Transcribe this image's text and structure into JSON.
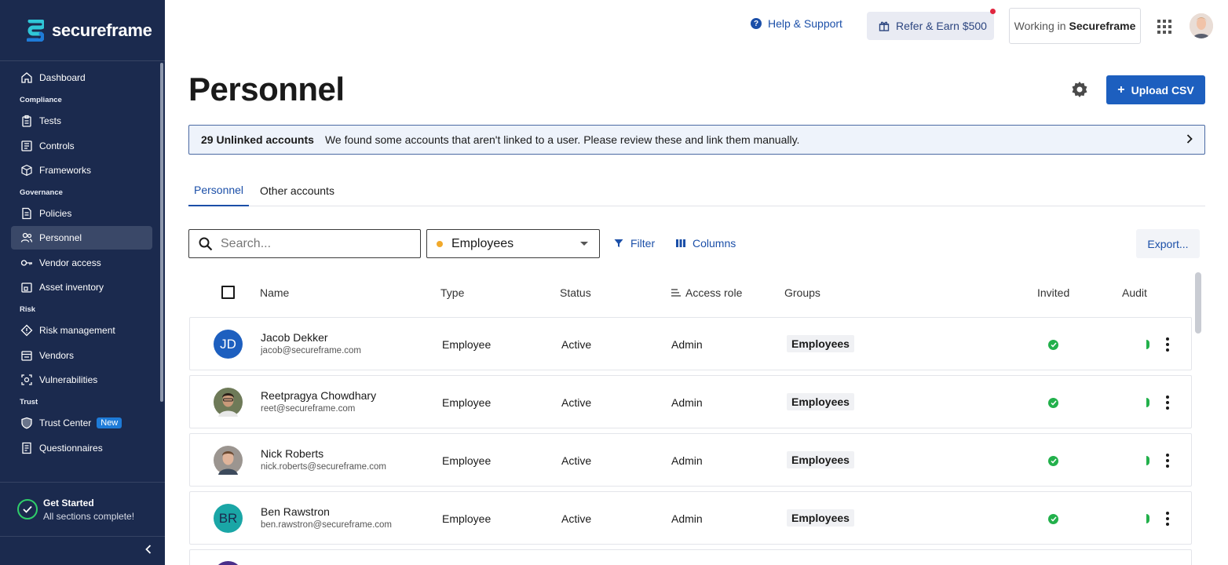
{
  "brand": {
    "name": "secureframe",
    "color": "#1b2a4e",
    "accent": "#1d5fbf"
  },
  "sidebar": {
    "items": [
      {
        "kind": "item",
        "label": "Dashboard",
        "icon": "home-icon"
      },
      {
        "kind": "section",
        "label": "Compliance"
      },
      {
        "kind": "item",
        "label": "Tests",
        "icon": "clipboard-icon"
      },
      {
        "kind": "item",
        "label": "Controls",
        "icon": "sliders-icon"
      },
      {
        "kind": "item",
        "label": "Frameworks",
        "icon": "cube-icon"
      },
      {
        "kind": "section",
        "label": "Governance"
      },
      {
        "kind": "item",
        "label": "Policies",
        "icon": "document-icon"
      },
      {
        "kind": "item",
        "label": "Personnel",
        "icon": "users-icon",
        "active": true
      },
      {
        "kind": "item",
        "label": "Vendor access",
        "icon": "key-icon"
      },
      {
        "kind": "item",
        "label": "Asset inventory",
        "icon": "device-icon"
      },
      {
        "kind": "section",
        "label": "Risk"
      },
      {
        "kind": "item",
        "label": "Risk management",
        "icon": "diamond-icon"
      },
      {
        "kind": "item",
        "label": "Vendors",
        "icon": "store-icon"
      },
      {
        "kind": "item",
        "label": "Vulnerabilities",
        "icon": "bug-icon"
      },
      {
        "kind": "section",
        "label": "Trust"
      },
      {
        "kind": "item",
        "label": "Trust Center",
        "icon": "shield-icon",
        "badge": "New"
      },
      {
        "kind": "item",
        "label": "Questionnaires",
        "icon": "list-icon"
      }
    ],
    "get_started": {
      "title": "Get Started",
      "subtitle": "All sections complete!"
    }
  },
  "topbar": {
    "help": "Help & Support",
    "refer": "Refer & Earn $500",
    "working_prefix": "Working in",
    "working_org": "Secureframe"
  },
  "page": {
    "title": "Personnel",
    "upload_label": "Upload CSV",
    "banner": {
      "count": "29 Unlinked accounts",
      "message": "We found some accounts that aren't linked to a user. Please review these and link them manually."
    },
    "tabs": [
      "Personnel",
      "Other accounts"
    ],
    "search_placeholder": "Search...",
    "select_value": "Employees",
    "filter_label": "Filter",
    "columns_label": "Columns",
    "export_label": "Export..."
  },
  "table": {
    "headers": {
      "name": "Name",
      "type": "Type",
      "status": "Status",
      "access_role": "Access role",
      "groups": "Groups",
      "invited": "Invited",
      "audit": "Audit"
    },
    "rows": [
      {
        "initials": "JD",
        "avatar_color": "#1d5fbf",
        "name": "Jacob Dekker",
        "email": "jacob@secureframe.com",
        "type": "Employee",
        "status": "Active",
        "role": "Admin",
        "group": "Employees"
      },
      {
        "initials": "",
        "avatar_color": "#5b4a3a",
        "name": "Reetpragya Chowdhary",
        "email": "reet@secureframe.com",
        "type": "Employee",
        "status": "Active",
        "role": "Admin",
        "group": "Employees"
      },
      {
        "initials": "",
        "avatar_color": "#7a6a5a",
        "name": "Nick Roberts",
        "email": "nick.roberts@secureframe.com",
        "type": "Employee",
        "status": "Active",
        "role": "Admin",
        "group": "Employees"
      },
      {
        "initials": "BR",
        "avatar_color": "#1aa6a6",
        "name": "Ben Rawstron",
        "email": "ben.rawstron@secureframe.com",
        "type": "Employee",
        "status": "Active",
        "role": "Admin",
        "group": "Employees"
      }
    ]
  }
}
